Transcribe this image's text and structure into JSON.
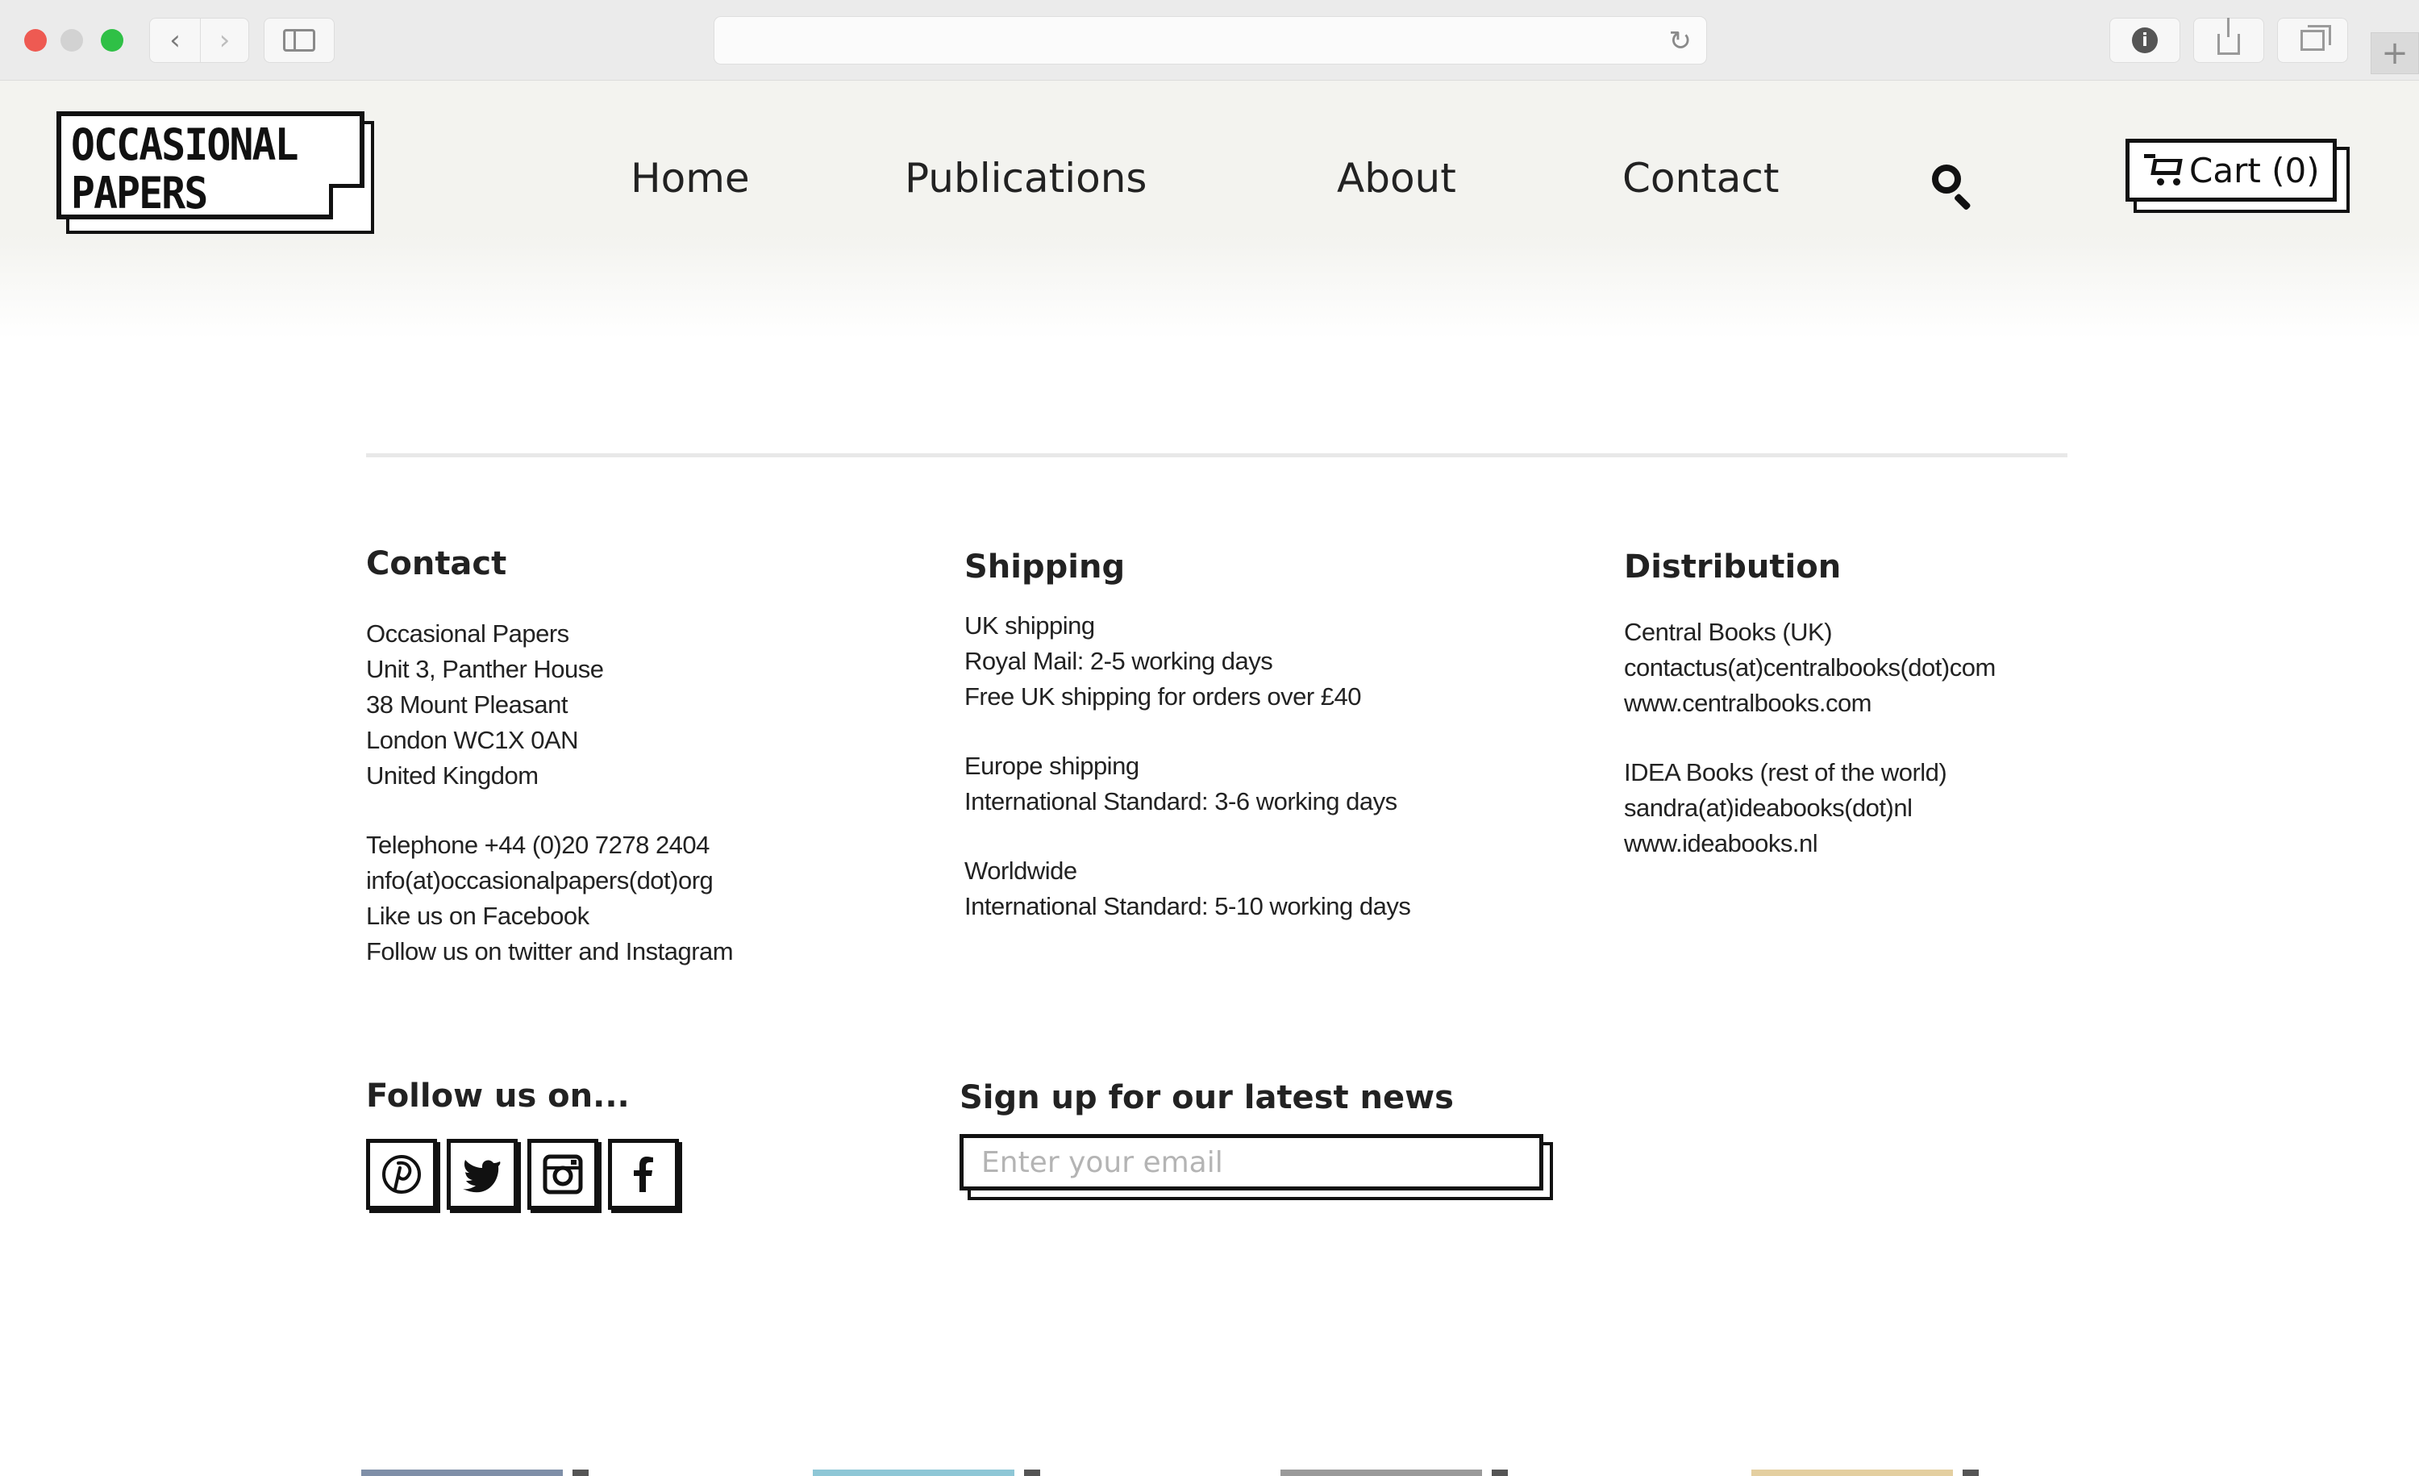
{
  "browser": {
    "back_glyph": "‹",
    "forward_glyph": "›",
    "reload_glyph": "↻",
    "newtab_glyph": "+",
    "info_glyph": "i",
    "icons": [
      "back-icon",
      "forward-icon",
      "sidebar-icon",
      "reload-icon",
      "info-icon",
      "share-icon",
      "tabs-icon",
      "new-tab-icon"
    ]
  },
  "header": {
    "logo_line1": "OCCASIONAL",
    "logo_line2": "PAPERS",
    "nav": {
      "home": "Home",
      "publications": "Publications",
      "about": "About",
      "contact": "Contact"
    },
    "cart_label": "Cart (0)"
  },
  "footer": {
    "contact": {
      "heading": "Contact",
      "address": [
        "Occasional Papers",
        "Unit 3, Panther House",
        "38 Mount Pleasant",
        "London WC1X 0AN",
        "United Kingdom"
      ],
      "details": [
        "Telephone +44 (0)20 7278 2404",
        "info(at)occasionalpapers(dot)org",
        "Like us on Facebook",
        "Follow us on twitter and Instagram"
      ]
    },
    "shipping": {
      "heading": "Shipping",
      "uk": [
        "UK shipping",
        "Royal Mail: 2-5 working days",
        "Free UK shipping for orders over £40"
      ],
      "europe": [
        "Europe shipping",
        "International Standard: 3-6 working days"
      ],
      "worldwide": [
        "Worldwide",
        "International Standard: 5-10 working days"
      ]
    },
    "distribution": {
      "heading": "Distribution",
      "uk": [
        "Central Books (UK)",
        "contactus(at)centralbooks(dot)com",
        "www.centralbooks.com"
      ],
      "world": [
        "IDEA Books (rest of the world)",
        "sandra(at)ideabooks(dot)nl",
        "www.ideabooks.nl"
      ]
    },
    "follow": {
      "heading": "Follow us on...",
      "networks": [
        "pinterest-icon",
        "twitter-icon",
        "instagram-icon",
        "facebook-icon"
      ]
    },
    "signup": {
      "heading": "Sign up for our latest news",
      "placeholder": "Enter your email"
    }
  },
  "colors": {
    "ink": "#111111",
    "header_bg": "#f3f3ef",
    "rule": "#e8e8e8",
    "placeholder": "#b4b4b4"
  }
}
